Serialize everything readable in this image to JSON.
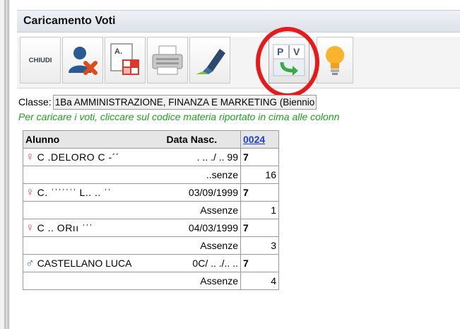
{
  "window": {
    "title": "Caricamento Voti"
  },
  "toolbar": {
    "close_label": "CHIUDI",
    "buttons": [
      {
        "icon": "user-remove-icon"
      },
      {
        "icon": "document-edit-icon"
      },
      {
        "icon": "printer-icon"
      },
      {
        "icon": "highlighter-icon"
      },
      {
        "icon": "transfer-pv-icon",
        "letters_left": "P",
        "letters_right": "V"
      },
      {
        "icon": "lightbulb-icon"
      }
    ]
  },
  "class_field": {
    "label": "Classe:",
    "value": "1Ba AMMINISTRAZIONE, FINANZA E MARKETING (Biennio"
  },
  "instruction": "Per caricare i voti, cliccare sul codice materia riportato in cima alle colonn",
  "table": {
    "headers": {
      "student": "Alunno",
      "birth_date": "Data Nasc.",
      "subject_code": "0024"
    },
    "rows": [
      {
        "gender": "♀",
        "name": "C  .DELORO C  ‐´´",
        "date": ". .. ./ .. 99",
        "grade": "7",
        "absence_label": "..senze",
        "absences": "16"
      },
      {
        "gender": "♀",
        "name": "C.  ˈˈˈˈˈˈˈ  L..  .. ˈˈ",
        "date": "03/09/1999",
        "grade": "7",
        "absence_label": "Assenze",
        "absences": "1"
      },
      {
        "gender": "♀",
        "name": "C     .. ORıı   ˈˈˈ",
        "date": "04/03/1999",
        "grade": "7",
        "absence_label": "Assenze",
        "absences": "3"
      },
      {
        "gender": "♂",
        "name": "CASTELLANO LUCA",
        "date": "0C/ .. ./.. ..",
        "grade": "7",
        "absence_label": "Assenze",
        "absences": "4"
      }
    ]
  },
  "colors": {
    "highlight_circle": "#e51b1b",
    "instruction_text": "#1da21d",
    "link": "#1f3fd8"
  }
}
